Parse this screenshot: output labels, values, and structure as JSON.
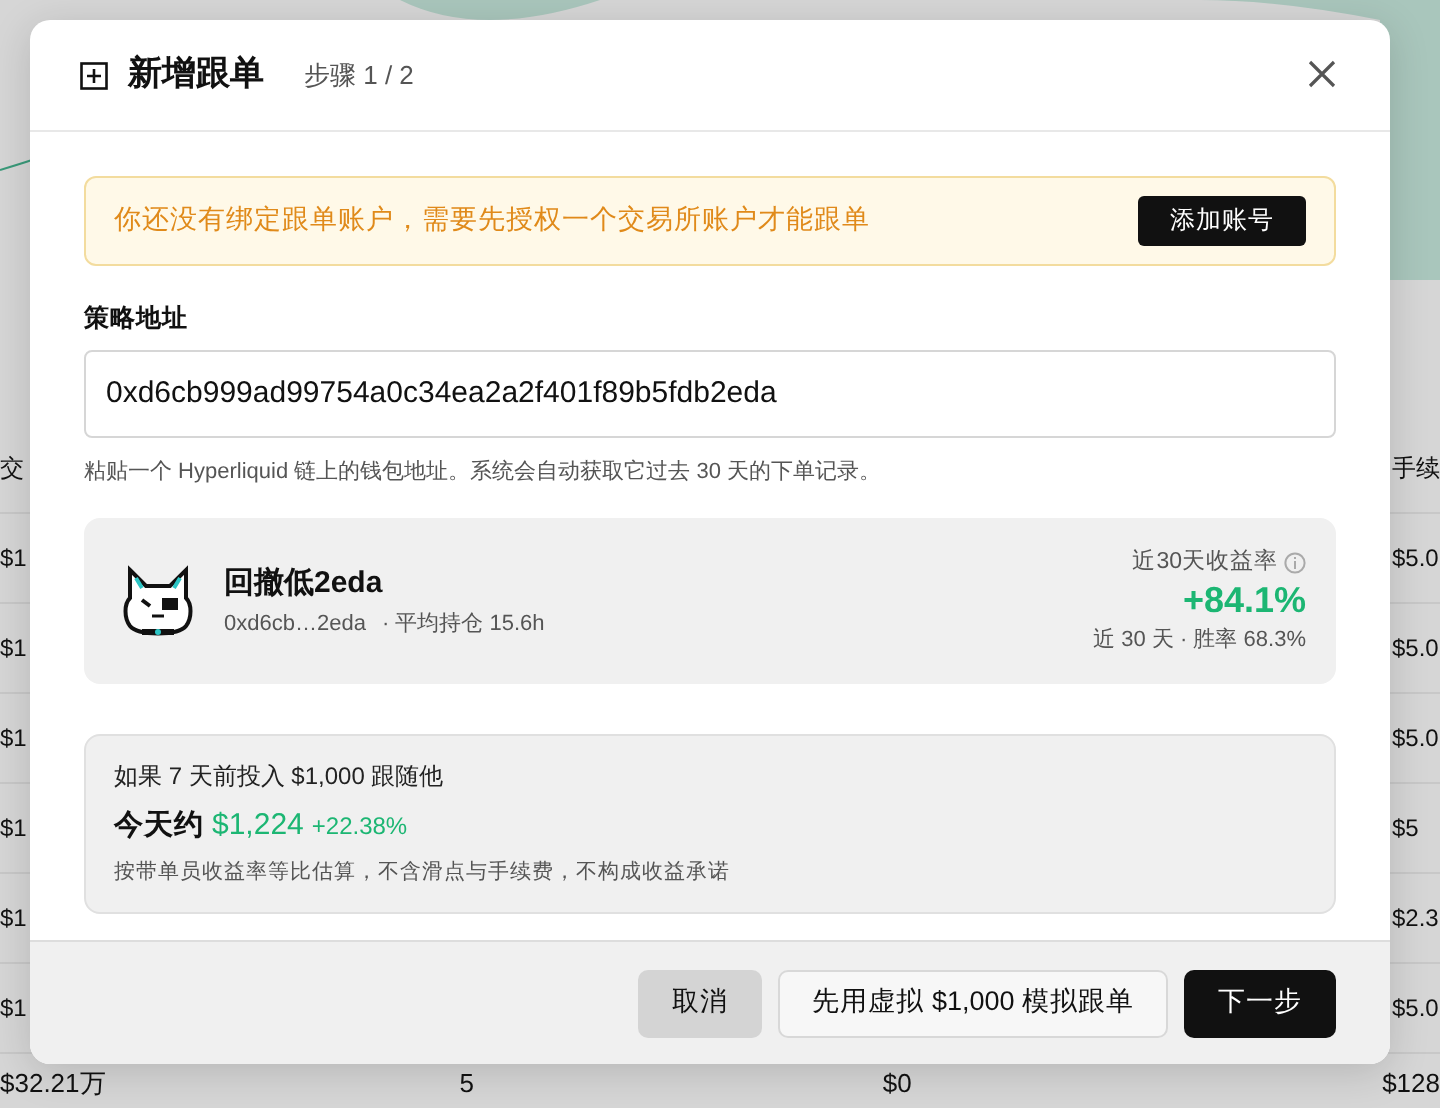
{
  "background_table": {
    "header": {
      "left": "交",
      "right": "手续"
    },
    "rows": [
      {
        "left": "$1",
        "right": "$5.0"
      },
      {
        "left": "$1",
        "right": "$5.0"
      },
      {
        "left": "$1",
        "right": "$5.0"
      },
      {
        "left": "$1",
        "right": "$5"
      },
      {
        "left": "$1",
        "right": "$2.3"
      },
      {
        "left": "$1",
        "right": "$5.0"
      }
    ],
    "last_row": [
      "$32.21万",
      "5",
      "$0",
      "$128"
    ]
  },
  "dialog": {
    "title": "新增跟单",
    "step": "步骤 1 / 2",
    "alert": {
      "message": "你还没有绑定跟单账户，需要先授权一个交易所账户才能跟单",
      "button": "添加账号"
    },
    "address_field": {
      "label": "策略地址",
      "value": "0xd6cb999ad99754a0c34ea2a2f401f89b5fdb2eda",
      "hint": "粘贴一个 Hyperliquid 链上的钱包地址。系统会自动获取它过去 30 天的下单记录。"
    },
    "trader": {
      "name": "回撤低2eda",
      "address": "0xd6cb…2eda",
      "avg_hold": "· 平均持仓 15.6h",
      "return_label": "近30天收益率",
      "return_value": "+84.1%",
      "stats": "近 30 天 · 胜率 68.3%"
    },
    "simulation": {
      "intro": "如果 7 天前投入 $1,000 跟随他",
      "result_label": "今天约",
      "result_value": "$1,224",
      "result_change": "+22.38%",
      "disclaimer": "按带单员收益率等比估算，不含滑点与手续费，不构成收益承诺"
    },
    "buttons": [
      {
        "label": "取消",
        "kind": "secondary"
      },
      {
        "label": "先用虚拟 $1,000 模拟跟单",
        "kind": "outline"
      },
      {
        "label": "下一步",
        "kind": "primary"
      }
    ]
  }
}
